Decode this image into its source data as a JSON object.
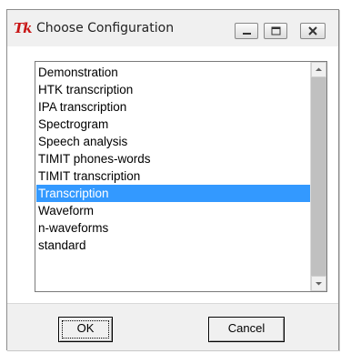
{
  "window": {
    "title": "Choose Configuration",
    "app_icon": "Tk"
  },
  "titlebar_buttons": {
    "minimize_icon": "minimize-icon",
    "maximize_icon": "maximize-icon",
    "close_icon": "close-icon"
  },
  "configurations": [
    {
      "label": "Demonstration",
      "selected": false
    },
    {
      "label": "HTK transcription",
      "selected": false
    },
    {
      "label": "IPA transcription",
      "selected": false
    },
    {
      "label": "Spectrogram",
      "selected": false
    },
    {
      "label": "Speech analysis",
      "selected": false
    },
    {
      "label": "TIMIT phones-words",
      "selected": false
    },
    {
      "label": "TIMIT transcription",
      "selected": false
    },
    {
      "label": "Transcription",
      "selected": true
    },
    {
      "label": "Waveform",
      "selected": false
    },
    {
      "label": "n-waveforms",
      "selected": false
    },
    {
      "label": "standard",
      "selected": false
    }
  ],
  "buttons": {
    "ok": "OK",
    "cancel": "Cancel"
  },
  "colors": {
    "selection": "#3399ff",
    "selection_text": "#ffffff",
    "scroll_track": "#c0c0c0",
    "icon_red": "#c81414"
  }
}
